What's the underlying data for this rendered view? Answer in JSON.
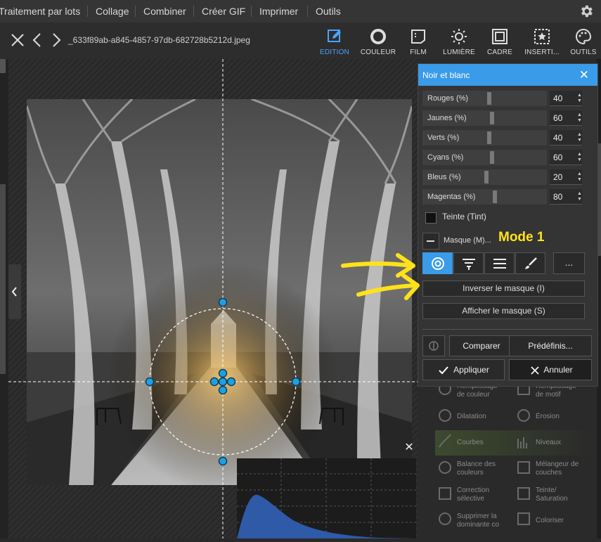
{
  "topmenu": {
    "items": [
      "Traitement par lots",
      "Collage",
      "Combiner",
      "Créer GIF",
      "Imprimer",
      "Outils"
    ]
  },
  "toolbar": {
    "filename": "_633f89ab-a845-4857-97db-682728b5212d.jpeg",
    "tools": [
      "EDITION",
      "COULEUR",
      "FILM",
      "LUMIÈRE",
      "CADRE",
      "INSERTI...",
      "OUTILS"
    ]
  },
  "dialog": {
    "title": "Noir et blanc",
    "sliders": [
      {
        "label": "Rouges (%)",
        "value": "40",
        "level": 40
      },
      {
        "label": "Jaunes (%)",
        "value": "60",
        "level": 60
      },
      {
        "label": "Verts (%)",
        "value": "40",
        "level": 40
      },
      {
        "label": "Cyans (%)",
        "value": "60",
        "level": 60
      },
      {
        "label": "Bleus (%)",
        "value": "20",
        "level": 20
      },
      {
        "label": "Magentas (%)",
        "value": "80",
        "level": 80
      }
    ],
    "tint_label": "Teinte (Tint)",
    "mask_label": "Masque (M)...",
    "more_label": "...",
    "invert_mask": "Inverser le masque (I)",
    "show_mask": "Afficher le masque (S)",
    "compare": "Comparer",
    "presets": "Prédéfinis...",
    "apply": "Appliquer",
    "cancel": "Annuler"
  },
  "annotation": {
    "mode_label": "Mode 1",
    "color": "#ffe21a"
  },
  "background_tools": [
    "Remplissage de couleur",
    "Remplissage de motif",
    "Dilatation",
    "Érosion",
    "Courbes",
    "Niveaux",
    "Balance des couleurs",
    "Mélangeur de couches",
    "Correction sélective",
    "Teinte/ Saturation",
    "Supprimer la dominante co",
    "Coloriser"
  ],
  "colors": {
    "accent": "#3a9be9",
    "handle": "#1fa0e0"
  }
}
